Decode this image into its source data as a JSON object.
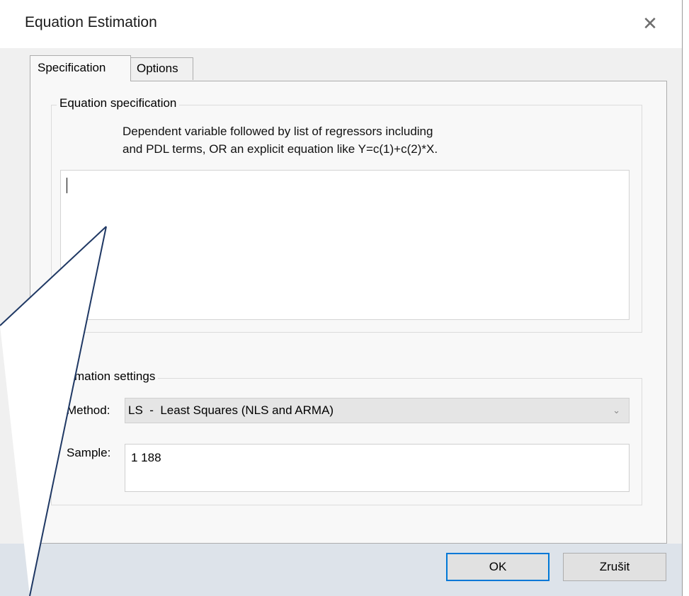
{
  "window": {
    "title": "Equation Estimation",
    "close_glyph": "✕"
  },
  "tabs": [
    {
      "label": "Specification",
      "active": true
    },
    {
      "label": "Options",
      "active": false
    }
  ],
  "equation_spec": {
    "legend": "Equation specification",
    "hint_line1": "Dependent variable followed by list of regressors including",
    "hint_line2": "and PDL terms, OR an explicit equation like Y=c(1)+c(2)*X.",
    "value": ""
  },
  "estimation": {
    "legend": "stimation settings",
    "method_label": "Method:",
    "method_value": "LS  -  Least Squares (NLS and ARMA)",
    "sample_label": "Sample:",
    "sample_value": "1 188"
  },
  "buttons": {
    "ok": "OK",
    "cancel": "Zrušit"
  },
  "colors": {
    "accent": "#0078d7",
    "callout_line": "#1f3864"
  }
}
